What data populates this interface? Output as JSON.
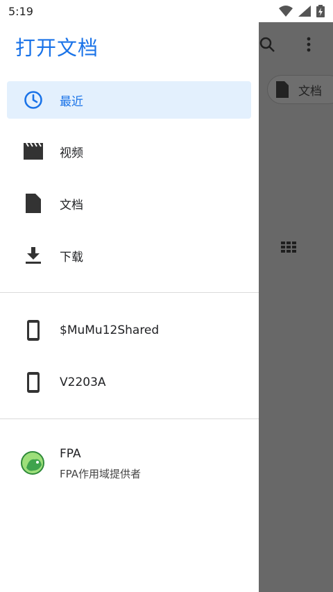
{
  "status_bar": {
    "time": "5:19"
  },
  "drawer": {
    "title": "打开文档",
    "nav_items": [
      {
        "label": "最近",
        "icon": "clock-icon",
        "active": true
      },
      {
        "label": "视频",
        "icon": "video-icon",
        "active": false
      },
      {
        "label": "文档",
        "icon": "document-icon",
        "active": false
      },
      {
        "label": "下载",
        "icon": "download-icon",
        "active": false
      }
    ],
    "roots": [
      {
        "label": "$MuMu12Shared",
        "icon": "phone-icon"
      },
      {
        "label": "V2203A",
        "icon": "phone-icon"
      }
    ],
    "apps": [
      {
        "name": "FPA",
        "subtitle": "FPA作用域提供者",
        "icon": "fpa-app-icon"
      }
    ]
  },
  "background": {
    "chip_label": "文档"
  },
  "colors": {
    "accent": "#1a73e8",
    "active_bg": "#e3f0fd",
    "scrim": "#686868"
  }
}
